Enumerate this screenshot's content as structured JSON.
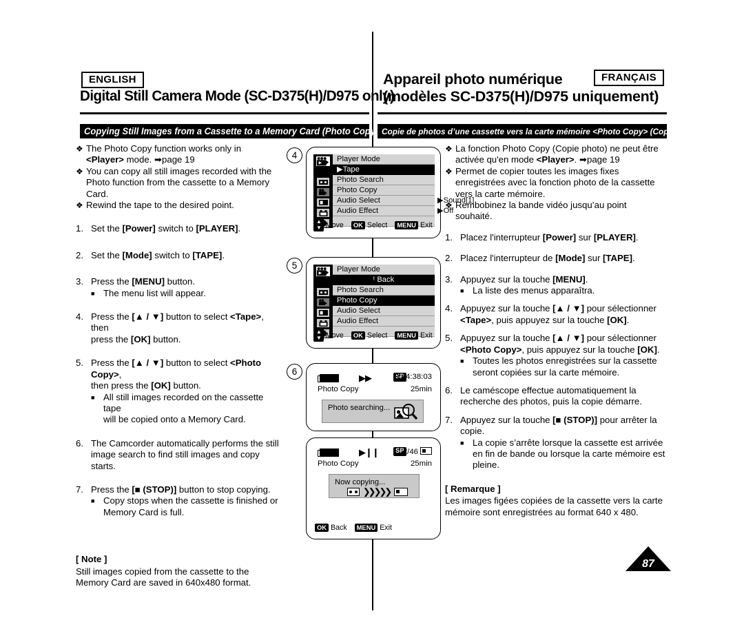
{
  "header": {
    "english_badge": "ENGLISH",
    "french_badge": "FRANÇAIS",
    "title_en": "Digital Still Camera Mode (SC-D375(H)/D975 only)",
    "title_fr_line1": "Appareil photo numérique",
    "title_fr_line2": "(modèles SC-D375(H)/D975 uniquement)",
    "section_en": "Copying Still Images from a Cassette to a Memory Card (Photo Copy)",
    "section_fr": "Copie de photos d’une cassette vers la carte mémoire <Photo Copy> (Copie Photo)"
  },
  "english": {
    "bullets": [
      {
        "line1_a": "The Photo Copy function works only in",
        "line2_pre": "",
        "bold": "<Player>",
        "line2_post": " mode. ➡page 19"
      },
      {
        "line1_a": "You can copy all still images recorded with the",
        "line2": "Photo function from the cassette to a Memory Card."
      },
      {
        "line1_a": "Rewind the tape to the desired point."
      }
    ],
    "steps": [
      {
        "num": "1.",
        "pre": "Set the ",
        "b1": "[Power]",
        "mid": " switch to ",
        "b2": "[PLAYER]",
        "post": "."
      },
      {
        "num": "2.",
        "pre": "Set the ",
        "b1": "[Mode]",
        "mid": " switch to ",
        "b2": "[TAPE]",
        "post": "."
      },
      {
        "num": "3.",
        "pre": "Press the ",
        "b1": "[MENU]",
        "mid": " button.",
        "b2": "",
        "post": ""
      }
    ],
    "step3_sub": "The menu list will appear.",
    "step4_line1_pre": "Press the ",
    "step4_b1": "[▲ / ▼]",
    "step4_line1_mid": " button to select ",
    "step4_b2": "<Tape>",
    "step4_line1_post": ", then",
    "step4_line2_pre": "press the ",
    "step4_b3": "[OK]",
    "step4_line2_post": " button.",
    "step5_line1_pre": "Press the ",
    "step5_b1": "[▲ / ▼]",
    "step5_line1_mid": " button to select ",
    "step5_b2": "<Photo Copy>",
    "step5_line1_post": ",",
    "step5_line2_pre": "then press the ",
    "step5_b3": "[OK]",
    "step5_line2_post": " button.",
    "step5_sub_line1": "All still images recorded on the cassette tape",
    "step5_sub_line2": "will be copied onto a Memory Card.",
    "step6_line1": "The Camcorder automatically performs the still",
    "step6_line2": "image search to find still images and copy starts.",
    "step7_pre": "Press the ",
    "step7_b1": "[■ (STOP)]",
    "step7_post": " button to stop copying.",
    "step7_sub_line1": "Copy stops when the cassette is finished or",
    "step7_sub_line2": "Memory Card is full.",
    "note_title": "[ Note ]",
    "note_line1": "Still images copied from the cassette to the",
    "note_line2": "Memory Card are saved in 640x480 format."
  },
  "french": {
    "b1_line1": "La fonction Photo Copy (Copie photo) ne peut être",
    "b1_line2_pre": "activée qu'en mode ",
    "b1_bold": "<Player>",
    "b1_line2_post": ". ➡page 19",
    "b2_line1": "Permet de copier toutes les images fixes",
    "b2_line2": "enregistrées avec la fonction photo de la cassette",
    "b2_line3": "vers la carte mémoire.",
    "b3_line1": "Rembobinez la bande vidéo jusqu’au point",
    "b3_line2": "souhaité.",
    "s1_pre": "Placez l'interrupteur ",
    "s1_b1": "[Power]",
    "s1_mid": " sur ",
    "s1_b2": "[PLAYER]",
    "s1_post": ".",
    "s2_pre": "Placez l'interrupteur de ",
    "s2_b1": "[Mode]",
    "s2_mid": " sur ",
    "s2_b2": "[TAPE]",
    "s2_post": ".",
    "s3_pre": "Appuyez sur la touche ",
    "s3_b1": "[MENU]",
    "s3_post": ".",
    "s3_sub": "La liste des menus apparaîtra.",
    "s4_line1_pre": "Appuyez sur la touche ",
    "s4_b1": "[▲ / ▼]",
    "s4_line1_post": " pour sélectionner",
    "s4_b2": "<Tape>",
    "s4_line2_mid": ", puis appuyez sur la touche ",
    "s4_b3": "[OK]",
    "s4_line2_post": ".",
    "s5_line1_pre": "Appuyez sur la touche ",
    "s5_b1": "[▲ / ▼]",
    "s5_line1_post": " pour sélectionner",
    "s5_b2": "<Photo Copy>",
    "s5_line2_mid": ", puis appuyez sur la touche ",
    "s5_b3": "[OK]",
    "s5_line2_post": ".",
    "s5_sub_line1": "Toutes les photos enregistrées sur la cassette",
    "s5_sub_line2": "seront copiées sur la carte mémoire.",
    "s6_line1": "Le caméscope effectue automatiquement la",
    "s6_line2": "recherche des photos, puis la copie démarre.",
    "s7_pre": "Appuyez sur la touche ",
    "s7_b1": "[■ (STOP)]",
    "s7_post": " pour arrêter la",
    "s7_line2": "copie.",
    "s7_sub_line1": "La copie s’arrête lorsque la cassette est arrivée",
    "s7_sub_line2": "en fin de bande ou lorsque la carte mémoire est",
    "s7_sub_line3": "pleine.",
    "note_title": "[ Remarque ]",
    "note_line1": "Les images figées copiées de la cassette vers la carte",
    "note_line2": "mémoire sont enregistrées au format 640 x 480."
  },
  "step_labels": {
    "four": "4",
    "five": "5",
    "six": "6"
  },
  "lcd1": {
    "title": "Player Mode",
    "rows": [
      {
        "label": "▶Tape",
        "value": "",
        "selected": true
      },
      {
        "label": "Photo Search",
        "value": "",
        "selected": false
      },
      {
        "label": "Photo Copy",
        "value": "",
        "selected": false
      },
      {
        "label": "Audio Select",
        "value": "▶Sound[1]",
        "selected": false
      },
      {
        "label": "Audio Effect",
        "value": "▶Off",
        "selected": false
      }
    ],
    "foot": {
      "move": "Move",
      "ok": "OK",
      "select": "Select",
      "menu": "MENU",
      "exit": "Exit"
    }
  },
  "lcd2": {
    "title": "Player Mode",
    "rows": [
      {
        "label": "ᵗ Back",
        "value": "",
        "selected": true
      },
      {
        "label": "Photo Search",
        "value": "",
        "selected": false
      },
      {
        "label": "Photo Copy",
        "value": "",
        "selected": true
      },
      {
        "label": "Audio Select",
        "value": "",
        "selected": false
      },
      {
        "label": "Audio Effect",
        "value": "",
        "selected": false
      }
    ],
    "foot": {
      "move": "Move",
      "ok": "OK",
      "select": "Select",
      "menu": "MENU",
      "exit": "Exit"
    }
  },
  "lcd3": {
    "transport": "▶▶",
    "sp": "SP",
    "timecode": "0:44:38:03",
    "mode_label": "Photo Copy",
    "remaining": "25min",
    "dialog_text": "Photo searching..."
  },
  "lcd4": {
    "transport": "▶❙❙",
    "sp": "SP",
    "counter": "2/46",
    "mode_label": "Photo Copy",
    "remaining": "25min",
    "dialog_text": "Now copying...",
    "foot": {
      "ok": "OK",
      "back": "Back",
      "menu": "MENU",
      "exit": "Exit"
    }
  },
  "page_number": "87",
  "colors": {
    "lcd_menu_bg": "#d4d4d4",
    "lcd_dialog_bg": "#c9c9c9",
    "selected": "#000000"
  }
}
